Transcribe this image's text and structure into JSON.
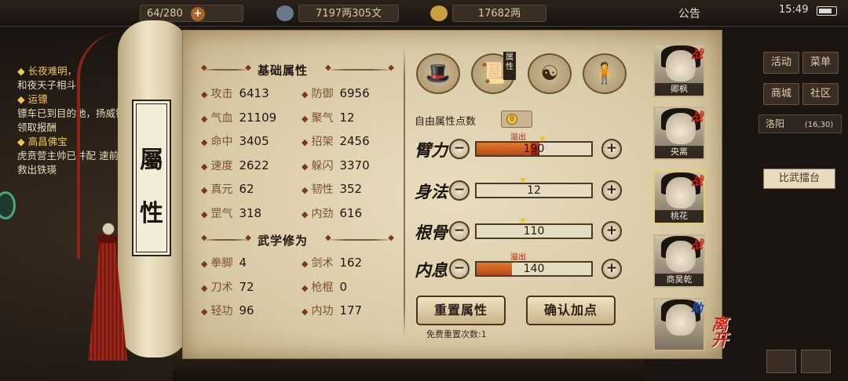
{
  "topbar": {
    "stamina": "64/280",
    "copper": "7197两305文",
    "silver": "17682两",
    "notice": "公告",
    "time": "15:49"
  },
  "quests": [
    {
      "title": "长夜难明，",
      "desc": "和夜天子相斗"
    },
    {
      "title": "运镖",
      "desc": "镖车已到目的地，扬威镖局领取报酬"
    },
    {
      "title": "高昌佛宝",
      "desc": "虎贲营主帅已并配 速前往救出铁瑛"
    }
  ],
  "right_menu": {
    "activity": "活动",
    "menu": "菜单",
    "shop": "商城",
    "community": "社区",
    "location": "洛阳",
    "coords": "(16,30)",
    "arena": "比武擂台"
  },
  "scroll_label": [
    "屬",
    "性"
  ],
  "base_attr": {
    "title": "基础属性",
    "left": [
      {
        "label": "攻击",
        "value": "6413"
      },
      {
        "label": "气血",
        "value": "21109"
      },
      {
        "label": "命中",
        "value": "3405"
      },
      {
        "label": "速度",
        "value": "2622"
      },
      {
        "label": "真元",
        "value": "62"
      },
      {
        "label": "罡气",
        "value": "318"
      }
    ],
    "right": [
      {
        "label": "防御",
        "value": "6956"
      },
      {
        "label": "聚气",
        "value": "12"
      },
      {
        "label": "招架",
        "value": "2456"
      },
      {
        "label": "躲闪",
        "value": "3370"
      },
      {
        "label": "韧性",
        "value": "352"
      },
      {
        "label": "内劲",
        "value": "616"
      }
    ]
  },
  "martial": {
    "title": "武学修为",
    "left": [
      {
        "label": "拳脚",
        "value": "4"
      },
      {
        "label": "刀术",
        "value": "72"
      },
      {
        "label": "轻功",
        "value": "96"
      }
    ],
    "right": [
      {
        "label": "剑术",
        "value": "162"
      },
      {
        "label": "枪棍",
        "value": "0"
      },
      {
        "label": "内功",
        "value": "177"
      }
    ]
  },
  "tab_active_label": "属性",
  "free_points_label": "自由属性点数",
  "free_points_value": "0",
  "attrs": [
    {
      "name": "臂力",
      "value": "190",
      "fill": 0.47,
      "over": 0.08,
      "overflow": "溢出"
    },
    {
      "name": "身法",
      "value": "12",
      "fill": 0.0,
      "over": 0.0,
      "overflow": ""
    },
    {
      "name": "根骨",
      "value": "110",
      "fill": 0.0,
      "over": 0.0,
      "overflow": ""
    },
    {
      "name": "内息",
      "value": "140",
      "fill": 0.31,
      "over": 0.0,
      "overflow": "溢出"
    }
  ],
  "buttons": {
    "reset": "重置属性",
    "confirm": "确认加点"
  },
  "free_reset": "免费重置次数:1",
  "party": [
    {
      "name": "卿枫",
      "tag": "战"
    },
    {
      "name": "央离",
      "tag": "战"
    },
    {
      "name": "桃花",
      "tag": "战"
    },
    {
      "name": "商昊乾",
      "tag": "战"
    },
    {
      "name": "",
      "tag": "助"
    }
  ],
  "leave": "离开",
  "colors": {
    "fight_tag": "#c81e10",
    "assist_tag": "#1e50b0",
    "bar_fill": "#d0661f",
    "overflow": "#b01a10"
  }
}
